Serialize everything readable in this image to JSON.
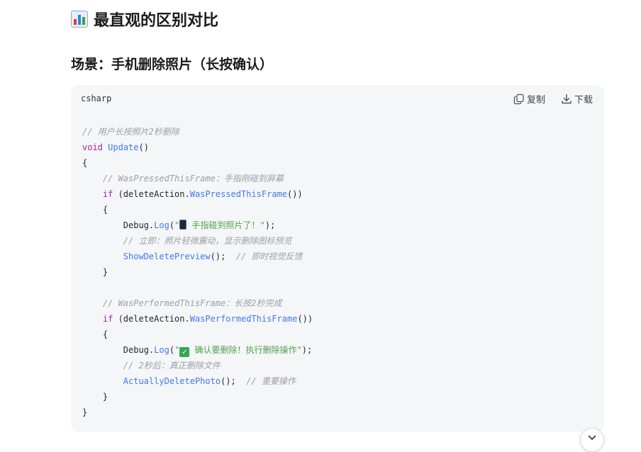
{
  "heading": {
    "text": "最直观的区别对比",
    "icon": "bar-chart-icon"
  },
  "subheading": {
    "text": "场景：手机删除照片（长按确认）"
  },
  "code_block": {
    "language": "csharp",
    "copy_label": "复制",
    "download_label": "下载",
    "lines": {
      "l1": "// 用户长按照片2秒删除",
      "l2_kw": "void",
      "l2_fn": "Update",
      "l2_rest": "()",
      "l3": "{",
      "l4": "// WasPressedThisFrame：手指刚碰到屏幕",
      "l5_kw": "if",
      "l5_a": " (deleteAction.",
      "l5_fn": "WasPressedThisFrame",
      "l5_b": "())",
      "l6": "{",
      "l7_a": "Debug.",
      "l7_fn": "Log",
      "l7_b": "(",
      "l7_str": " 手指碰到照片了！\"",
      "l7_c": ");",
      "l8": "// 立即：照片轻微震动，显示删除图标预览",
      "l9_fn": "ShowDeletePreview",
      "l9_a": "();  ",
      "l9_cm": "// 即时视觉反馈",
      "l10": "}",
      "l12": "// WasPerformedThisFrame：长按2秒完成",
      "l13_kw": "if",
      "l13_a": " (deleteAction.",
      "l13_fn": "WasPerformedThisFrame",
      "l13_b": "())",
      "l14": "{",
      "l15_a": "Debug.",
      "l15_fn": "Log",
      "l15_b": "(",
      "l15_str": " 确认要删除！执行删除操作\"",
      "l15_c": ");",
      "l16": "// 2秒后：真正删除文件",
      "l17_fn": "ActuallyDeletePhoto",
      "l17_a": "();  ",
      "l17_cm": "// 重要操作",
      "l18": "}",
      "l19": "}"
    }
  },
  "scroll_button": {
    "icon": "chevron-down-icon"
  },
  "colors": {
    "keyword": "#a626a4",
    "function": "#4078f2",
    "string": "#50a14f",
    "comment": "#9aa0a6",
    "card_bg": "#f5f6f8"
  }
}
